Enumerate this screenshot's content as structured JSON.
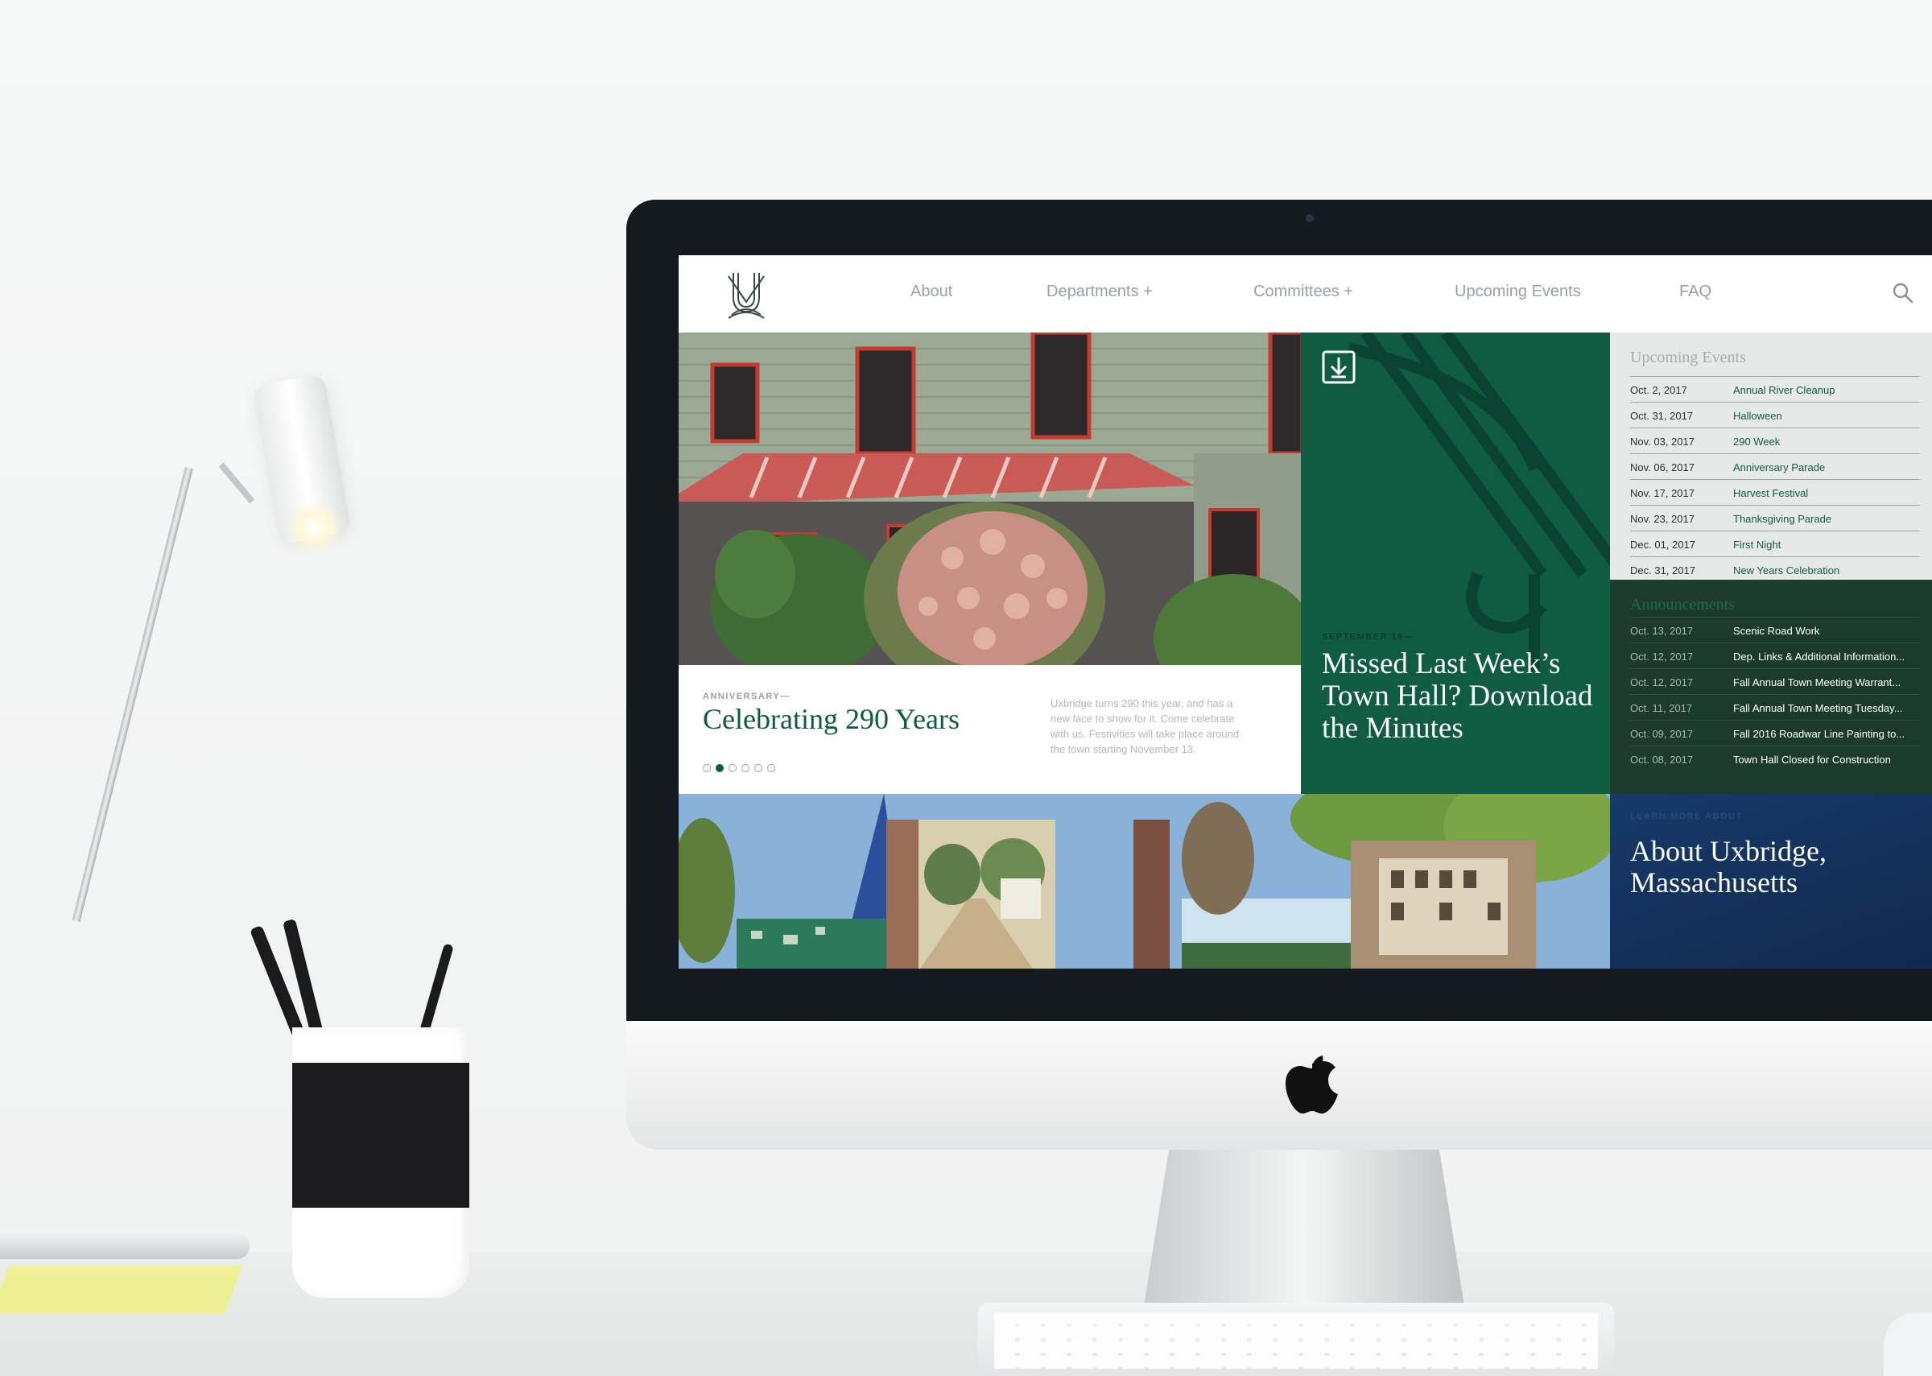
{
  "nav": {
    "items": [
      "About",
      "Departments +",
      "Committees +",
      "Upcoming Events",
      "FAQ"
    ]
  },
  "hero": {
    "kicker": "ANNIVERSARY—",
    "title": "Celebrating 290 Years",
    "description": "Uxbridge turns 290 this year, and has a new face to show for it. Come celebrate with us. Festivities will take place around the town starting November 13.",
    "slides": 6,
    "active_slide": 2
  },
  "feature": {
    "kicker": "SEPTEMBER 19—",
    "title": "Missed Last Week’s Town Hall? Download the Minutes"
  },
  "upcoming_events": {
    "title": "Upcoming Events",
    "items": [
      {
        "date": "Oct. 2, 2017",
        "name": "Annual River Cleanup"
      },
      {
        "date": "Oct. 31, 2017",
        "name": "Halloween"
      },
      {
        "date": "Nov. 03, 2017",
        "name": "290 Week"
      },
      {
        "date": "Nov. 06, 2017",
        "name": "Anniversary Parade"
      },
      {
        "date": "Nov. 17, 2017",
        "name": "Harvest Festival"
      },
      {
        "date": "Nov. 23, 2017",
        "name": "Thanksgiving Parade"
      },
      {
        "date": "Dec. 01, 2017",
        "name": "First Night"
      },
      {
        "date": "Dec. 31, 2017",
        "name": "New Years Celebration"
      }
    ]
  },
  "announcements": {
    "title": "Announcements",
    "items": [
      {
        "date": "Oct. 13, 2017",
        "name": "Scenic Road Work"
      },
      {
        "date": "Oct. 12, 2017",
        "name": "Dep. Links & Additional Information..."
      },
      {
        "date": "Oct. 12, 2017",
        "name": "Fall Annual Town Meeting Warrant..."
      },
      {
        "date": "Oct. 11, 2017",
        "name": "Fall Annual Town Meeting Tuesday..."
      },
      {
        "date": "Oct. 09, 2017",
        "name": "Fall 2016 Roadwar Line Painting to..."
      },
      {
        "date": "Oct. 08, 2017",
        "name": "Town Hall Closed for Construction"
      }
    ]
  },
  "about": {
    "kicker": "LEARN MORE ABOUT",
    "title_line1": "About Uxbridge,",
    "title_line2": "Massachusetts"
  },
  "colors": {
    "brand_green": "#0f5c43",
    "dark_green": "#1d3b2d",
    "navy": "#173a6a",
    "events_bg": "#e7e8e8"
  },
  "icons": [
    "uxbridge-logo",
    "search-icon",
    "download-icon",
    "apple-logo"
  ]
}
